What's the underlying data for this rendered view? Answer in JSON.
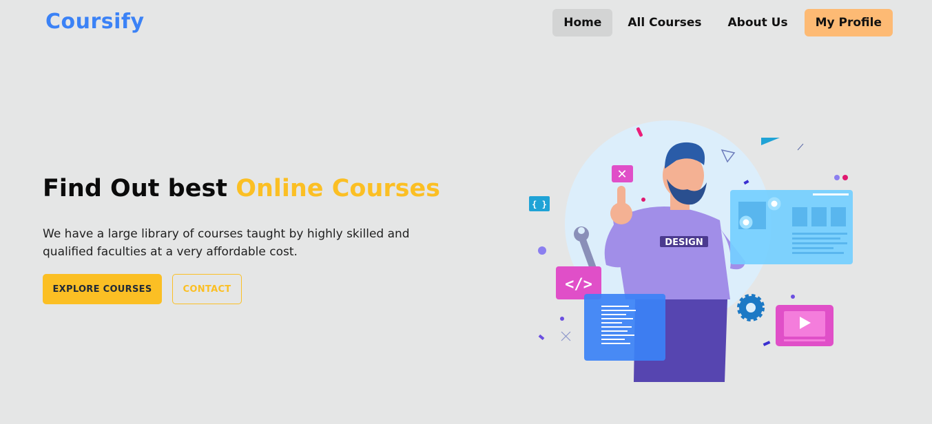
{
  "brand": {
    "name": "Coursify"
  },
  "nav": {
    "items": [
      {
        "label": "Home",
        "active": true
      },
      {
        "label": "All Courses"
      },
      {
        "label": "About Us"
      },
      {
        "label": "My Profile"
      }
    ]
  },
  "hero": {
    "title_part1": "Find Out best",
    "title_highlight": "Online Courses",
    "description": "We have a large library of courses taught by highly skilled and qualified faculties at a very affordable cost.",
    "primary_button": "EXPLORE COURSES",
    "secondary_button": "CONTACT"
  },
  "illustration": {
    "shirt_text": "DESIGN",
    "code_tag": "</>",
    "bracket_tag": "{ }"
  },
  "colors": {
    "brand_blue": "#3b82f6",
    "accent_yellow": "#fbbf24",
    "profile_orange": "#fdba74",
    "background": "#e5e6e6"
  }
}
